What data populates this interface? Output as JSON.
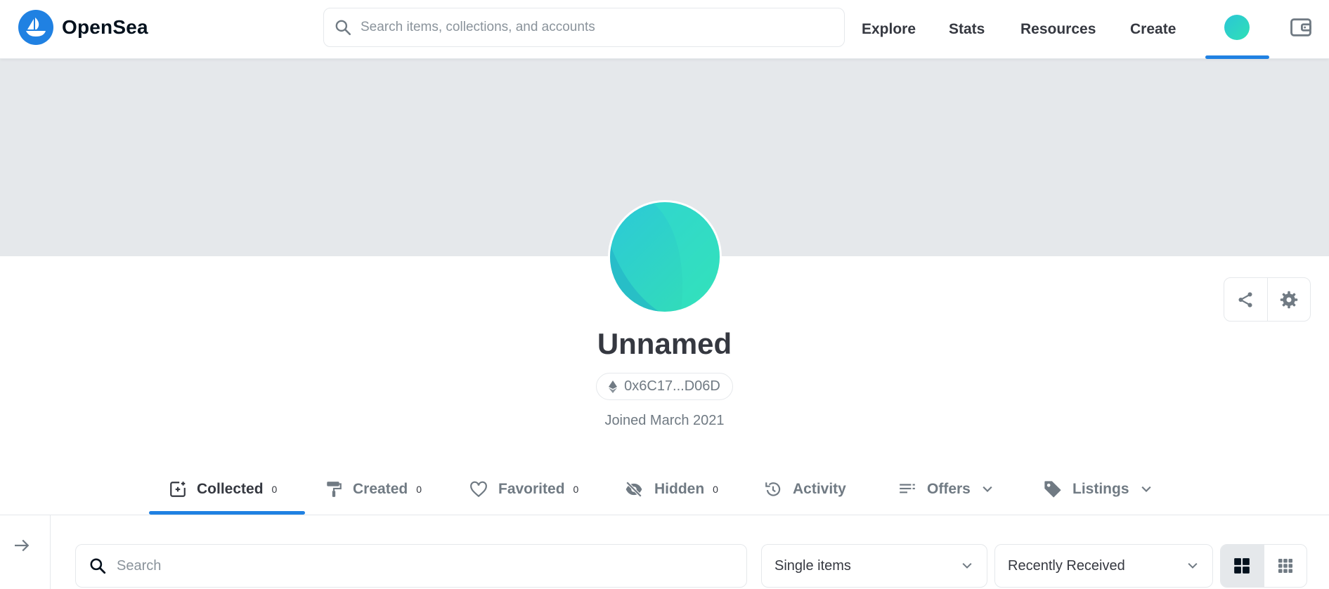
{
  "brand": {
    "name": "OpenSea",
    "accent": "#2081e2"
  },
  "header": {
    "search_placeholder": "Search items, collections, and accounts",
    "nav": [
      "Explore",
      "Stats",
      "Resources",
      "Create"
    ],
    "profile_icon": "avatar-icon",
    "wallet_icon": "wallet-icon"
  },
  "profile": {
    "name": "Unnamed",
    "address": "0x6C17...D06D",
    "joined": "Joined March 2021",
    "share_icon": "share-icon",
    "settings_icon": "gear-icon"
  },
  "tabs": [
    {
      "label": "Collected",
      "count": "0",
      "icon": "collected-icon",
      "active": true
    },
    {
      "label": "Created",
      "count": "0",
      "icon": "paint-roller-icon"
    },
    {
      "label": "Favorited",
      "count": "0",
      "icon": "heart-icon"
    },
    {
      "label": "Hidden",
      "count": "0",
      "icon": "eye-off-icon"
    },
    {
      "label": "Activity",
      "icon": "history-icon"
    },
    {
      "label": "Offers",
      "icon": "list-icon",
      "dropdown": true
    },
    {
      "label": "Listings",
      "icon": "tag-icon",
      "dropdown": true
    }
  ],
  "filters": {
    "search_placeholder": "Search",
    "item_type": "Single items",
    "sort": "Recently Received",
    "view_modes": [
      "large-grid-icon",
      "small-grid-icon"
    ]
  }
}
